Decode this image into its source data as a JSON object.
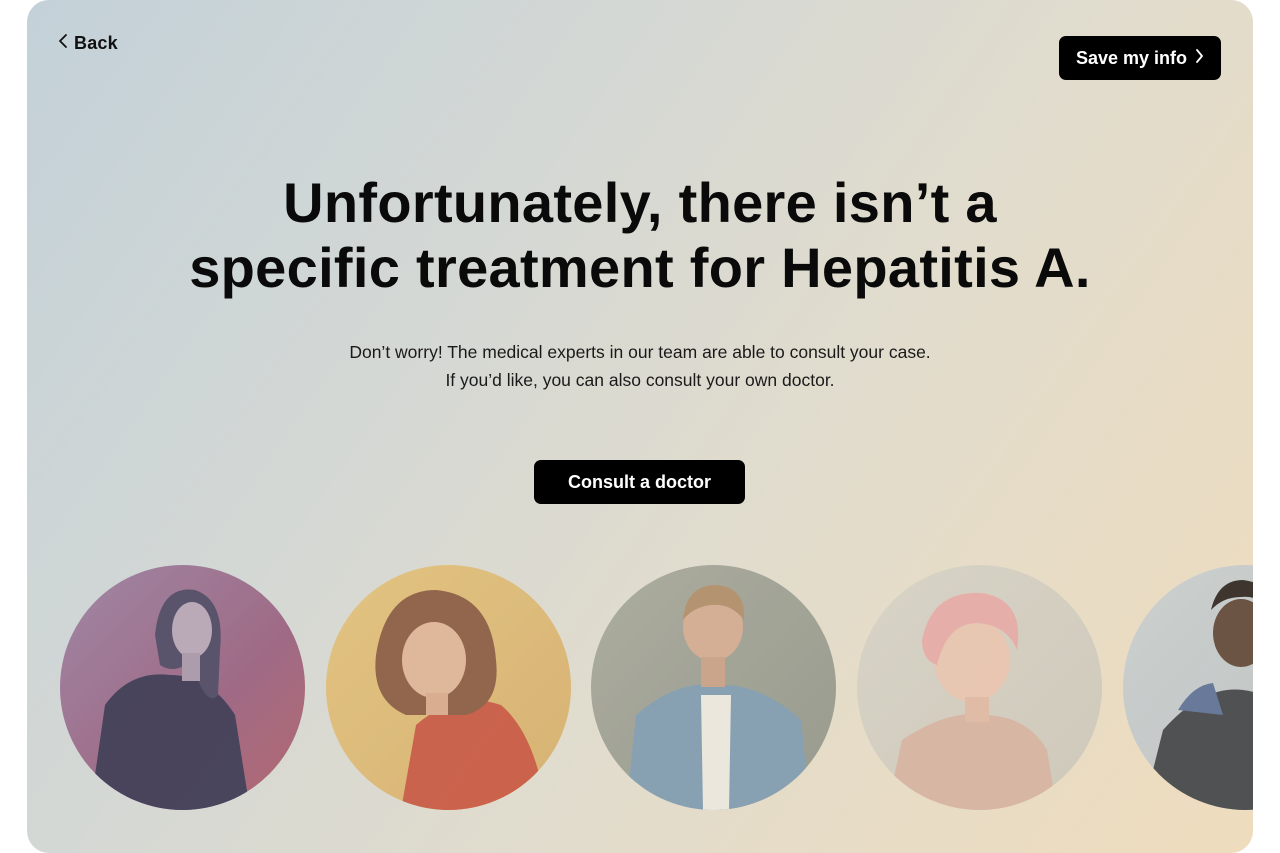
{
  "nav": {
    "back_label": "Back",
    "save_label": "Save my info"
  },
  "hero": {
    "headline_line1": "Unfortunately, there isn’t a",
    "headline_line2": "specific treatment for Hepatitis A.",
    "subtext_line1": "Don’t worry! The medical experts in our team are able to consult your case.",
    "subtext_line2": "If you’d like, you can also consult your own doctor.",
    "cta_label": "Consult a doctor"
  },
  "icons": {
    "back": "chevron-left-icon",
    "save": "chevron-right-icon"
  },
  "colors": {
    "button_bg": "#000000",
    "button_text": "#ffffff",
    "gradient_start": "#c3d1d9",
    "gradient_end": "#efdcbd"
  },
  "doctors": [
    {
      "name": "doctor-photo-1"
    },
    {
      "name": "doctor-photo-2"
    },
    {
      "name": "doctor-photo-3"
    },
    {
      "name": "doctor-photo-4"
    },
    {
      "name": "doctor-photo-5"
    }
  ]
}
